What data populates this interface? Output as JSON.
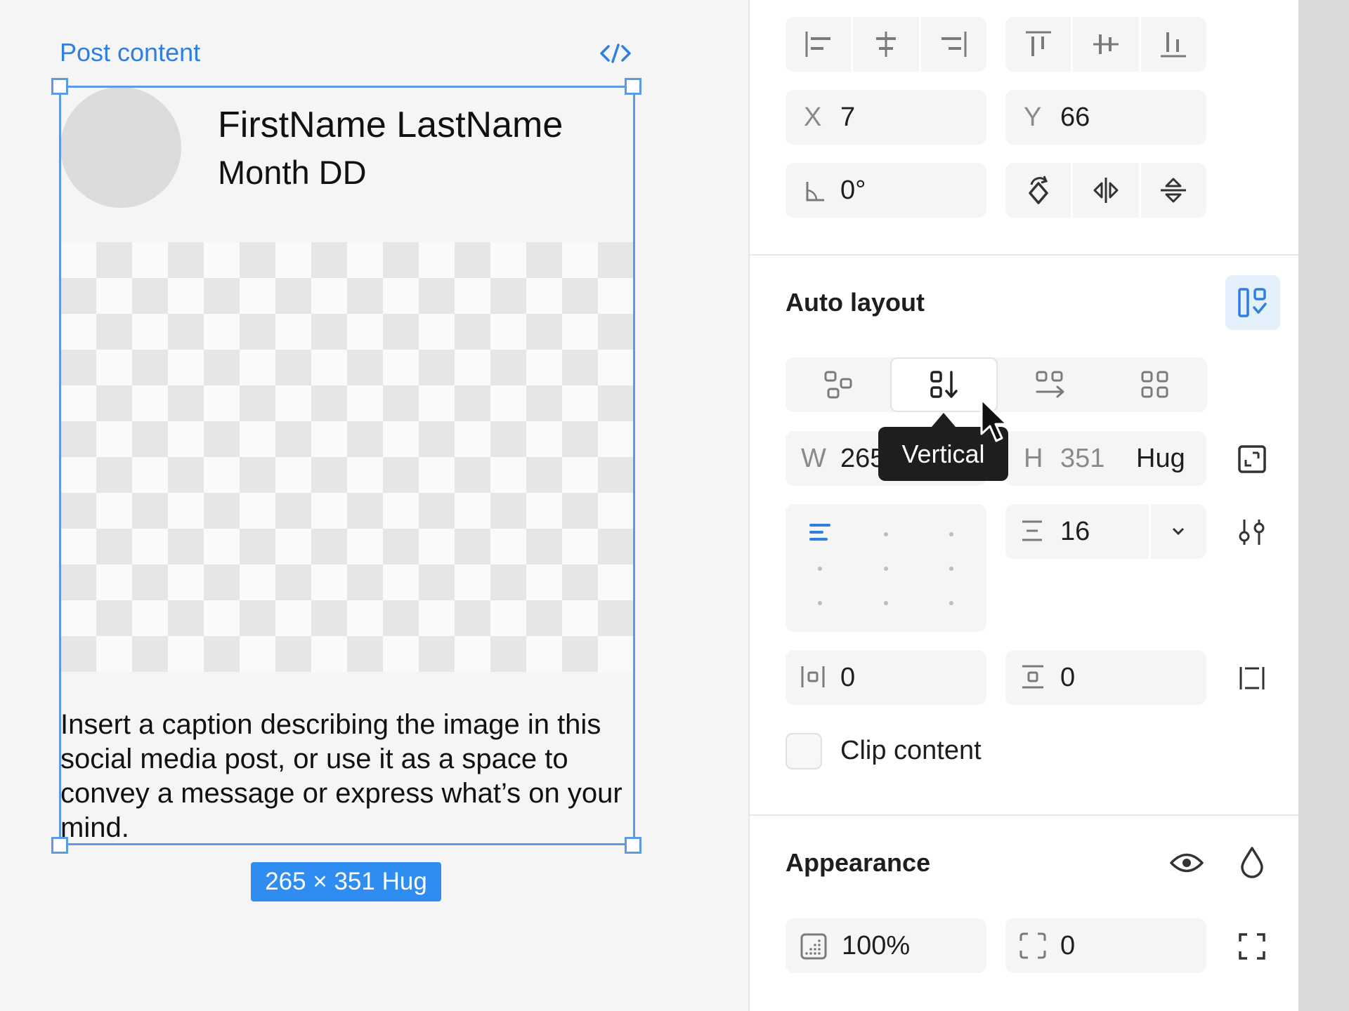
{
  "canvas": {
    "frame_label": "Post content",
    "post": {
      "name": "FirstName LastName",
      "date": "Month DD",
      "caption": "Insert a caption describing the image in this social media post, or use it as a space to convey a message or express what’s on your mind."
    },
    "size_badge": "265 × 351 Hug"
  },
  "panel": {
    "position": {
      "x_label": "X",
      "x_value": "7",
      "y_label": "Y",
      "y_value": "66",
      "rotation_value": "0°"
    },
    "auto_layout": {
      "title": "Auto layout",
      "direction_selected": "Vertical",
      "tooltip": "Vertical",
      "w_label": "W",
      "w_value": "265",
      "h_label": "H",
      "h_value": "351",
      "h_mode": "Hug",
      "gap_value": "16",
      "padding_horizontal": "0",
      "padding_vertical": "0",
      "clip_content_label": "Clip content",
      "clip_content_checked": false
    },
    "appearance": {
      "title": "Appearance",
      "opacity_value": "100%",
      "corner_radius_value": "0"
    }
  },
  "colors": {
    "accent": "#2f8cf0",
    "selection": "#5a9ae6",
    "panel_field": "#f5f5f5",
    "tooltip": "#1e1e1e"
  }
}
